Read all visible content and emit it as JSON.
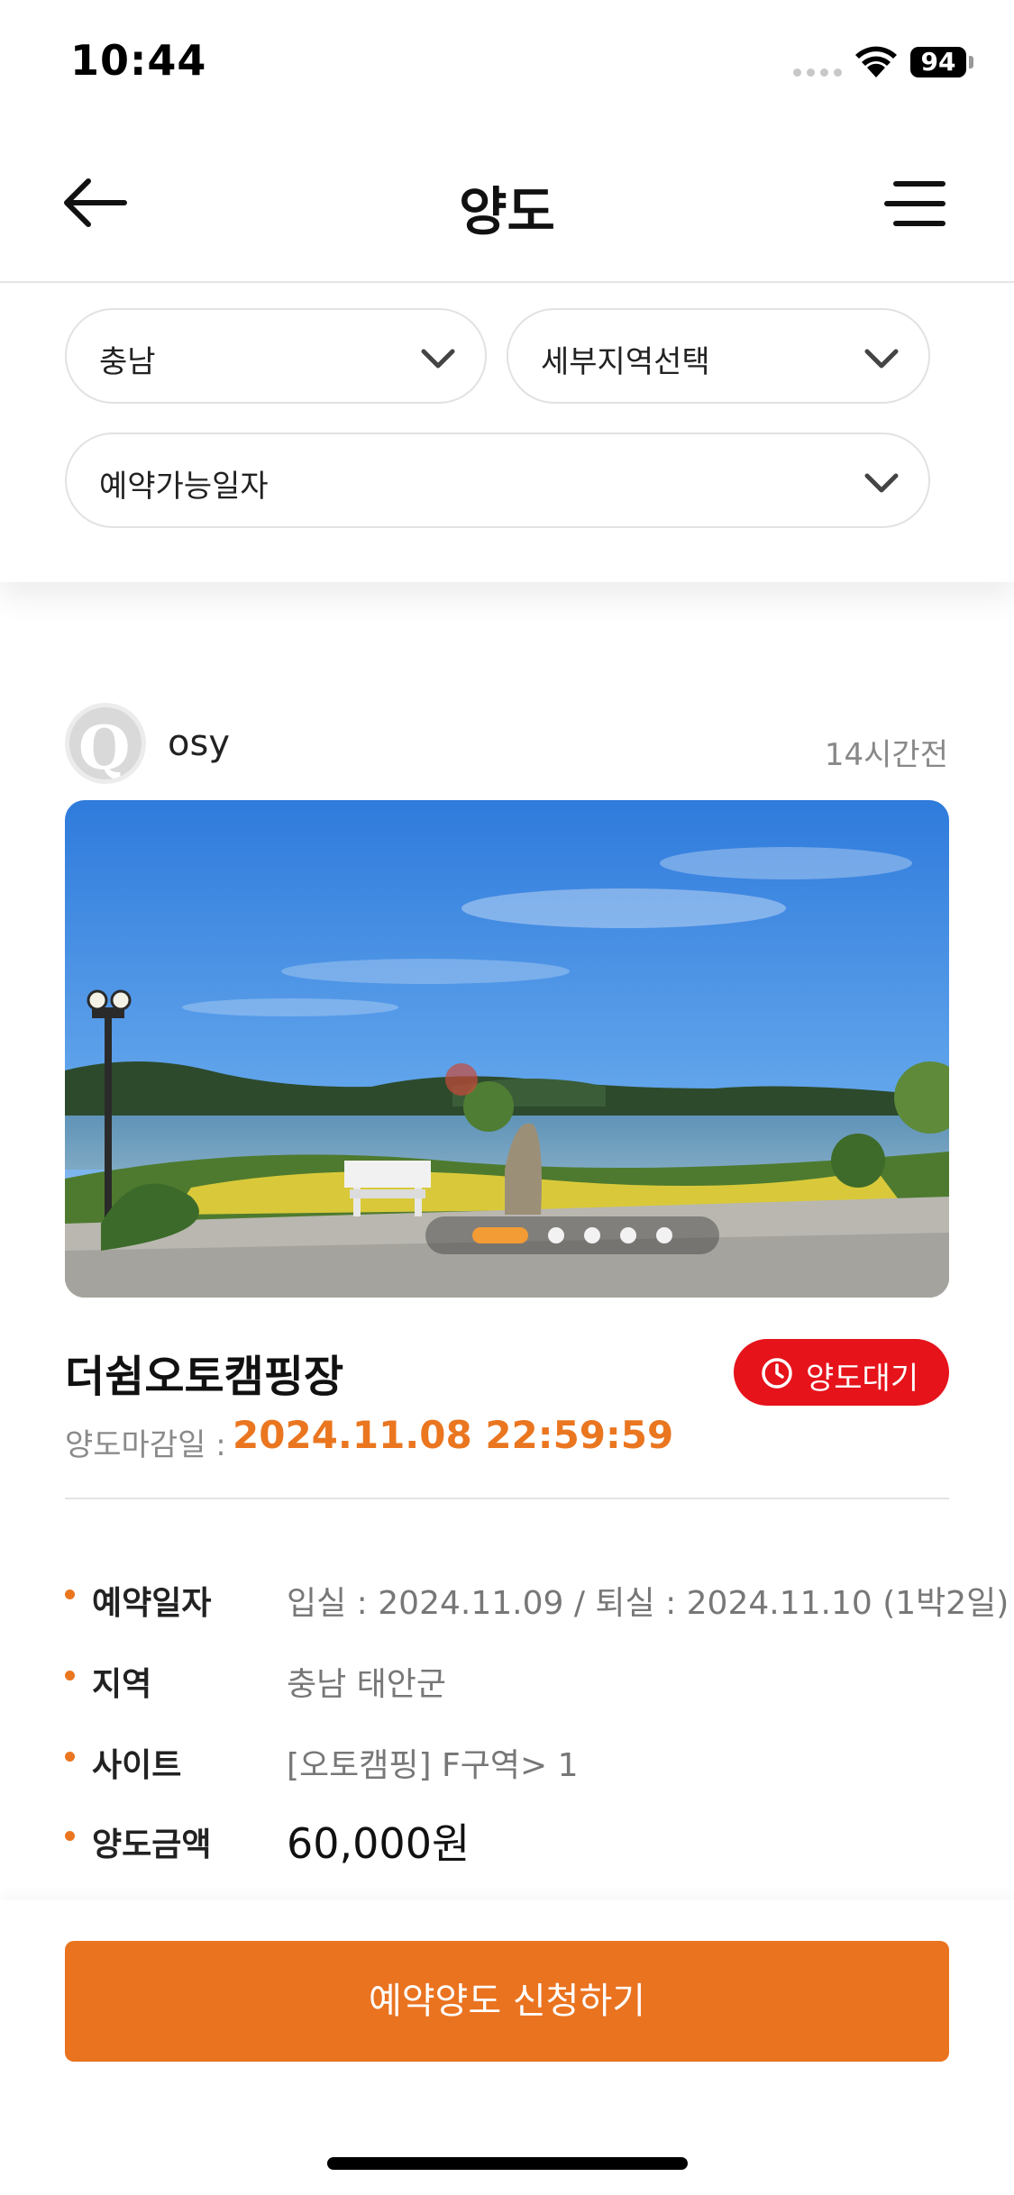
{
  "status_bar": {
    "time": "10:44",
    "battery": "94"
  },
  "header": {
    "title": "양도"
  },
  "filters": {
    "region": "충남",
    "sub_region": "세부지역선택",
    "date": "예약가능일자"
  },
  "post": {
    "author": "osy",
    "time_ago": "14시간전",
    "photo_count": 5,
    "active_photo": 1,
    "camp_name": "더쉼오토캠핑장",
    "status": "양도대기",
    "deadline_label": "양도마감일 :",
    "deadline": "2024.11.08 22:59:59",
    "details": [
      {
        "key": "예약일자",
        "value": "입실 : 2024.11.09 / 퇴실 : 2024.11.10 (1박2일)"
      },
      {
        "key": "지역",
        "value": "충남 태안군"
      },
      {
        "key": "사이트",
        "value": "[오토캠핑] F구역> 1"
      },
      {
        "key": "양도금액",
        "value": "60,000원"
      }
    ]
  },
  "cta": {
    "label": "예약양도 신청하기"
  },
  "colors": {
    "accent": "#ea7320",
    "status_red": "#e6131b"
  }
}
